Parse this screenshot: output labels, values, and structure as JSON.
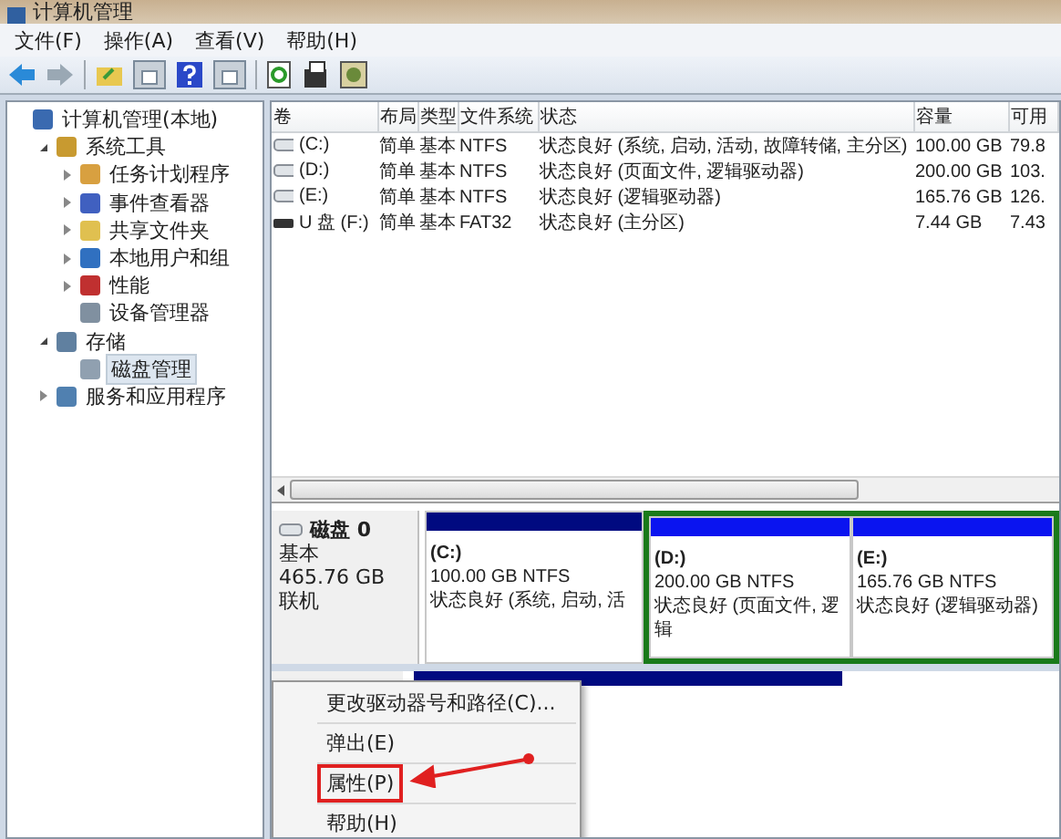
{
  "window": {
    "title": "计算机管理"
  },
  "menu": [
    "文件(F)",
    "操作(A)",
    "查看(V)",
    "帮助(H)"
  ],
  "tree": {
    "label": "计算机管理(本地)",
    "selected": false,
    "children": [
      {
        "label": "系统工具",
        "expanded": true,
        "selected": false,
        "children": [
          {
            "label": "任务计划程序",
            "expanded": false,
            "selected": false
          },
          {
            "label": "事件查看器",
            "expanded": false,
            "selected": false
          },
          {
            "label": "共享文件夹",
            "expanded": false,
            "selected": false
          },
          {
            "label": "本地用户和组",
            "expanded": false,
            "selected": false
          },
          {
            "label": "性能",
            "expanded": false,
            "selected": false
          },
          {
            "label": "设备管理器",
            "selected": false
          }
        ]
      },
      {
        "label": "存储",
        "expanded": true,
        "selected": false,
        "children": [
          {
            "label": "磁盘管理",
            "selected": true
          }
        ]
      },
      {
        "label": "服务和应用程序",
        "expanded": false,
        "selected": false
      }
    ]
  },
  "table": {
    "columns": [
      "卷",
      "布局",
      "类型",
      "文件系统",
      "状态",
      "容量",
      "可用"
    ],
    "rows": [
      {
        "kind": "hdd",
        "cells": [
          "(C:)",
          "简单",
          "基本",
          "NTFS",
          "状态良好 (系统, 启动, 活动, 故障转储, 主分区)",
          "100.00 GB",
          "79.8"
        ]
      },
      {
        "kind": "hdd",
        "cells": [
          "(D:)",
          "简单",
          "基本",
          "NTFS",
          "状态良好 (页面文件, 逻辑驱动器)",
          "200.00 GB",
          "103."
        ]
      },
      {
        "kind": "hdd",
        "cells": [
          "(E:)",
          "简单",
          "基本",
          "NTFS",
          "状态良好 (逻辑驱动器)",
          "165.76 GB",
          "126."
        ]
      },
      {
        "kind": "usb",
        "cells": [
          "U 盘 (F:)",
          "简单",
          "基本",
          "FAT32",
          "状态良好 (主分区)",
          "7.44 GB",
          "7.43"
        ]
      }
    ]
  },
  "disk": {
    "name": "磁盘 0",
    "type": "基本",
    "size": "465.76 GB",
    "status": "联机",
    "partitions": [
      {
        "kind": "primary",
        "selected": false,
        "name": "(C:)",
        "size": "100.00 GB NTFS",
        "status": "状态良好 (系统, 启动, 活"
      },
      {
        "kind": "extended",
        "selected": true,
        "children": [
          {
            "kind": "logical",
            "name": "(D:)",
            "size": "200.00 GB NTFS",
            "status": "状态良好 (页面文件, 逻辑"
          },
          {
            "kind": "logical",
            "name": "(E:)",
            "size": "165.76 GB NTFS",
            "status": "状态良好 (逻辑驱动器)"
          }
        ]
      }
    ]
  },
  "context_menu": [
    {
      "label": "更改驱动器号和路径(C)...",
      "marked": false
    },
    {
      "label": "弹出(E)",
      "marked": false
    },
    {
      "label": "属性(P)",
      "marked": true
    },
    {
      "label": "帮助(H)",
      "marked": false
    }
  ]
}
